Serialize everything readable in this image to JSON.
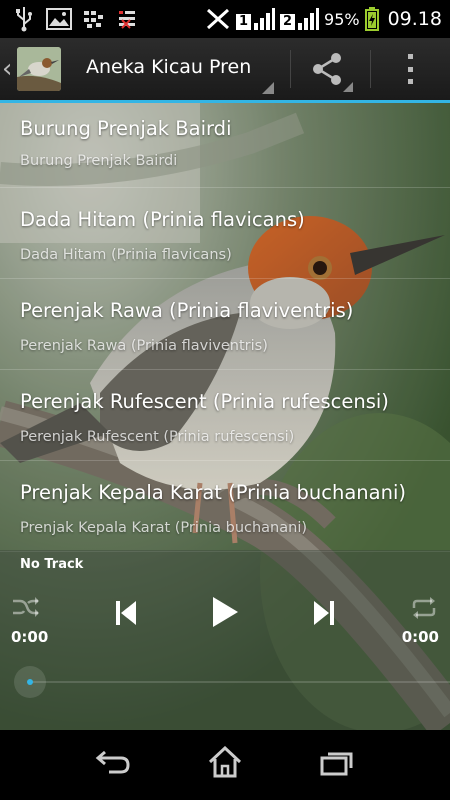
{
  "status_bar": {
    "battery_percent": "95%",
    "time": "09.18",
    "sim1": "1",
    "sim2": "2",
    "icons": [
      "usb-icon",
      "image-icon",
      "bbm-icon",
      "signal-off-icon",
      "no-data-icon",
      "signal-bars-icon",
      "battery-charging-icon"
    ]
  },
  "action_bar": {
    "title": "Aneka Kicau Prenjak",
    "icons": [
      "back-chevron-icon",
      "app-bird-icon",
      "share-icon",
      "overflow-menu-icon"
    ]
  },
  "tracks": [
    {
      "title": "Burung Prenjak Bairdi",
      "subtitle": "Burung Prenjak Bairdi"
    },
    {
      "title": "Dada Hitam (Prinia flavicans)",
      "subtitle": "Dada Hitam (Prinia flavicans)"
    },
    {
      "title": "Perenjak Rawa (Prinia flaviventris)",
      "subtitle": "Perenjak Rawa (Prinia flaviventris)"
    },
    {
      "title": "Perenjak Rufescent (Prinia rufescensi)",
      "subtitle": "Perenjak Rufescent (Prinia rufescensi)"
    },
    {
      "title": "Prenjak Kepala Karat (Prinia buchanani)",
      "subtitle": "Prenjak Kepala Karat (Prinia buchanani)"
    }
  ],
  "player": {
    "now_playing": "No Track",
    "time_elapsed": "0:00",
    "time_total": "0:00",
    "progress": 0,
    "icons": [
      "shuffle-icon",
      "previous-icon",
      "play-icon",
      "next-icon",
      "repeat-icon"
    ]
  },
  "nav_bar": {
    "icons": [
      "back-icon",
      "home-icon",
      "recent-apps-icon"
    ]
  },
  "colors": {
    "accent": "#33b5e5",
    "action_bar": "#222222",
    "text_primary": "#ffffff"
  }
}
